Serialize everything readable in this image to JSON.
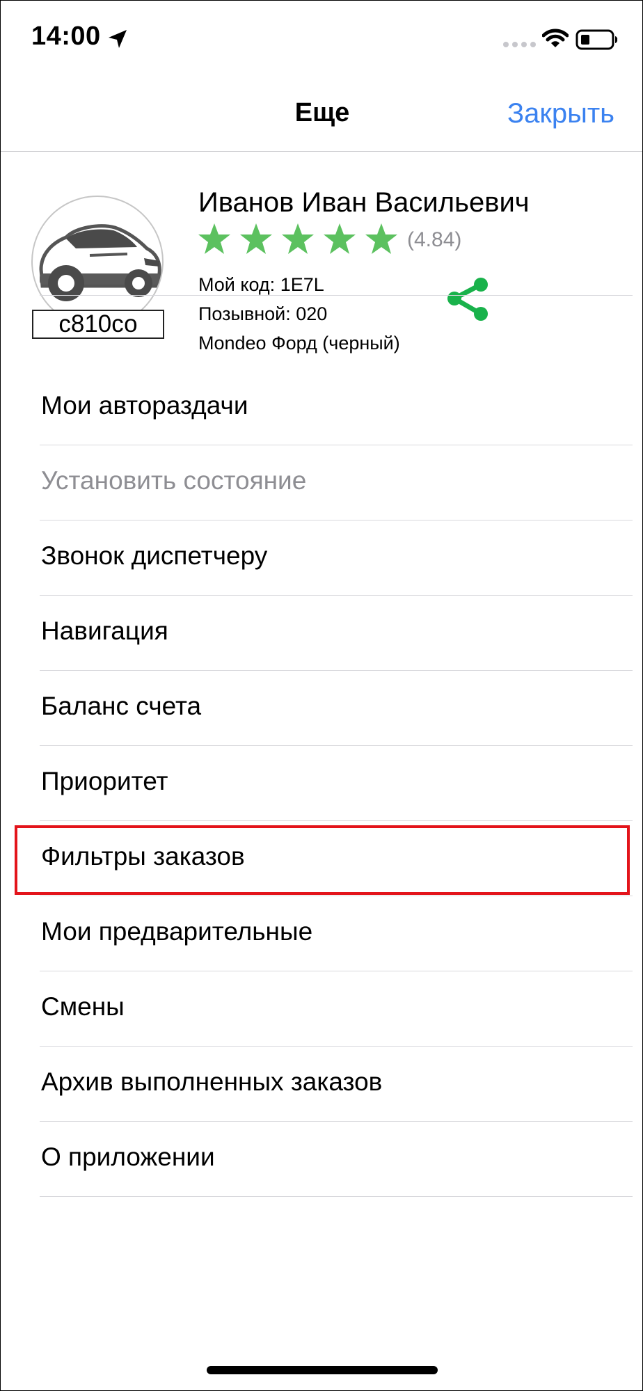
{
  "status_bar": {
    "time": "14:00"
  },
  "nav": {
    "title": "Еще",
    "close_label": "Закрыть"
  },
  "profile": {
    "name": "Иванов Иван Васильевич",
    "rating_stars": 5,
    "rating": "(4.84)",
    "code": "Мой код: 1E7L",
    "callsign": "Позывной: 020",
    "car": "Mondeo Форд (черный)",
    "plate": "с810со"
  },
  "menu": {
    "items": [
      {
        "label": "Мои автораздачи"
      },
      {
        "label": "Установить состояние"
      },
      {
        "label": "Звонок диспетчеру"
      },
      {
        "label": "Навигация"
      },
      {
        "label": "Баланс счета"
      },
      {
        "label": "Приоритет"
      },
      {
        "label": "Фильтры заказов"
      },
      {
        "label": "Мои предварительные"
      },
      {
        "label": "Смены"
      },
      {
        "label": "Архив выполненных заказов"
      },
      {
        "label": "О приложении"
      }
    ]
  },
  "colors": {
    "accent": "#3b82f0",
    "star": "#5cc15f",
    "share": "#19b24b",
    "highlight": "#e3141b"
  }
}
